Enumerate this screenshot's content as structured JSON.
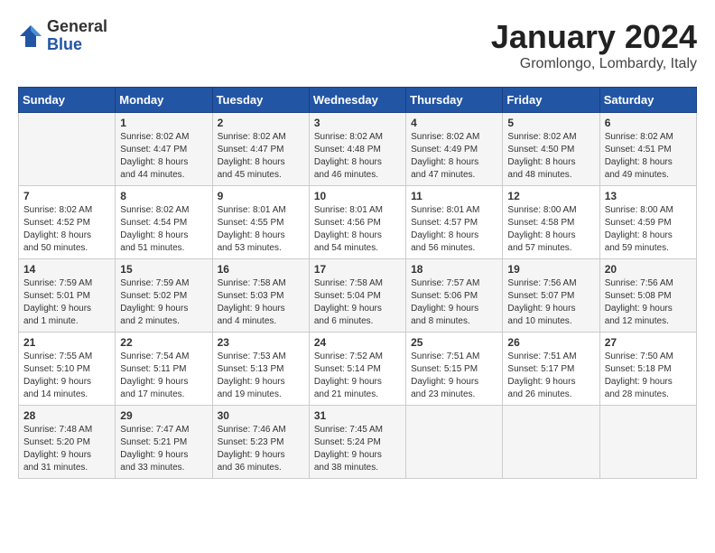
{
  "logo": {
    "general": "General",
    "blue": "Blue"
  },
  "title": "January 2024",
  "subtitle": "Gromlongo, Lombardy, Italy",
  "days_of_week": [
    "Sunday",
    "Monday",
    "Tuesday",
    "Wednesday",
    "Thursday",
    "Friday",
    "Saturday"
  ],
  "weeks": [
    [
      {
        "day": "",
        "info": ""
      },
      {
        "day": "1",
        "info": "Sunrise: 8:02 AM\nSunset: 4:47 PM\nDaylight: 8 hours\nand 44 minutes."
      },
      {
        "day": "2",
        "info": "Sunrise: 8:02 AM\nSunset: 4:47 PM\nDaylight: 8 hours\nand 45 minutes."
      },
      {
        "day": "3",
        "info": "Sunrise: 8:02 AM\nSunset: 4:48 PM\nDaylight: 8 hours\nand 46 minutes."
      },
      {
        "day": "4",
        "info": "Sunrise: 8:02 AM\nSunset: 4:49 PM\nDaylight: 8 hours\nand 47 minutes."
      },
      {
        "day": "5",
        "info": "Sunrise: 8:02 AM\nSunset: 4:50 PM\nDaylight: 8 hours\nand 48 minutes."
      },
      {
        "day": "6",
        "info": "Sunrise: 8:02 AM\nSunset: 4:51 PM\nDaylight: 8 hours\nand 49 minutes."
      }
    ],
    [
      {
        "day": "7",
        "info": "Sunrise: 8:02 AM\nSunset: 4:52 PM\nDaylight: 8 hours\nand 50 minutes."
      },
      {
        "day": "8",
        "info": "Sunrise: 8:02 AM\nSunset: 4:54 PM\nDaylight: 8 hours\nand 51 minutes."
      },
      {
        "day": "9",
        "info": "Sunrise: 8:01 AM\nSunset: 4:55 PM\nDaylight: 8 hours\nand 53 minutes."
      },
      {
        "day": "10",
        "info": "Sunrise: 8:01 AM\nSunset: 4:56 PM\nDaylight: 8 hours\nand 54 minutes."
      },
      {
        "day": "11",
        "info": "Sunrise: 8:01 AM\nSunset: 4:57 PM\nDaylight: 8 hours\nand 56 minutes."
      },
      {
        "day": "12",
        "info": "Sunrise: 8:00 AM\nSunset: 4:58 PM\nDaylight: 8 hours\nand 57 minutes."
      },
      {
        "day": "13",
        "info": "Sunrise: 8:00 AM\nSunset: 4:59 PM\nDaylight: 8 hours\nand 59 minutes."
      }
    ],
    [
      {
        "day": "14",
        "info": "Sunrise: 7:59 AM\nSunset: 5:01 PM\nDaylight: 9 hours\nand 1 minute."
      },
      {
        "day": "15",
        "info": "Sunrise: 7:59 AM\nSunset: 5:02 PM\nDaylight: 9 hours\nand 2 minutes."
      },
      {
        "day": "16",
        "info": "Sunrise: 7:58 AM\nSunset: 5:03 PM\nDaylight: 9 hours\nand 4 minutes."
      },
      {
        "day": "17",
        "info": "Sunrise: 7:58 AM\nSunset: 5:04 PM\nDaylight: 9 hours\nand 6 minutes."
      },
      {
        "day": "18",
        "info": "Sunrise: 7:57 AM\nSunset: 5:06 PM\nDaylight: 9 hours\nand 8 minutes."
      },
      {
        "day": "19",
        "info": "Sunrise: 7:56 AM\nSunset: 5:07 PM\nDaylight: 9 hours\nand 10 minutes."
      },
      {
        "day": "20",
        "info": "Sunrise: 7:56 AM\nSunset: 5:08 PM\nDaylight: 9 hours\nand 12 minutes."
      }
    ],
    [
      {
        "day": "21",
        "info": "Sunrise: 7:55 AM\nSunset: 5:10 PM\nDaylight: 9 hours\nand 14 minutes."
      },
      {
        "day": "22",
        "info": "Sunrise: 7:54 AM\nSunset: 5:11 PM\nDaylight: 9 hours\nand 17 minutes."
      },
      {
        "day": "23",
        "info": "Sunrise: 7:53 AM\nSunset: 5:13 PM\nDaylight: 9 hours\nand 19 minutes."
      },
      {
        "day": "24",
        "info": "Sunrise: 7:52 AM\nSunset: 5:14 PM\nDaylight: 9 hours\nand 21 minutes."
      },
      {
        "day": "25",
        "info": "Sunrise: 7:51 AM\nSunset: 5:15 PM\nDaylight: 9 hours\nand 23 minutes."
      },
      {
        "day": "26",
        "info": "Sunrise: 7:51 AM\nSunset: 5:17 PM\nDaylight: 9 hours\nand 26 minutes."
      },
      {
        "day": "27",
        "info": "Sunrise: 7:50 AM\nSunset: 5:18 PM\nDaylight: 9 hours\nand 28 minutes."
      }
    ],
    [
      {
        "day": "28",
        "info": "Sunrise: 7:48 AM\nSunset: 5:20 PM\nDaylight: 9 hours\nand 31 minutes."
      },
      {
        "day": "29",
        "info": "Sunrise: 7:47 AM\nSunset: 5:21 PM\nDaylight: 9 hours\nand 33 minutes."
      },
      {
        "day": "30",
        "info": "Sunrise: 7:46 AM\nSunset: 5:23 PM\nDaylight: 9 hours\nand 36 minutes."
      },
      {
        "day": "31",
        "info": "Sunrise: 7:45 AM\nSunset: 5:24 PM\nDaylight: 9 hours\nand 38 minutes."
      },
      {
        "day": "",
        "info": ""
      },
      {
        "day": "",
        "info": ""
      },
      {
        "day": "",
        "info": ""
      }
    ]
  ]
}
